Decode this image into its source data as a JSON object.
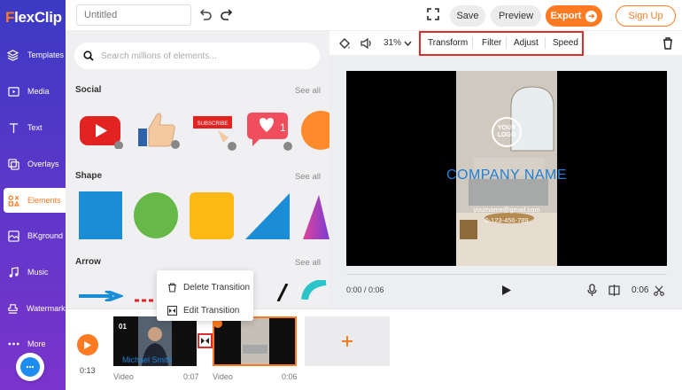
{
  "brand": {
    "logo_f": "F",
    "logo_rest": "lexClip",
    "accent": "#ff7a21",
    "sidebar_gradient": [
      "#3b3ac4",
      "#7b34cc"
    ]
  },
  "sidebar": {
    "items": [
      {
        "label": "Templates",
        "icon": "layers-icon"
      },
      {
        "label": "Media",
        "icon": "media-icon"
      },
      {
        "label": "Text",
        "icon": "text-icon"
      },
      {
        "label": "Overlays",
        "icon": "overlays-icon"
      },
      {
        "label": "Elements",
        "icon": "elements-icon",
        "active": true
      },
      {
        "label": "BKground",
        "icon": "background-icon"
      },
      {
        "label": "Music",
        "icon": "music-icon"
      },
      {
        "label": "Watermark",
        "icon": "watermark-icon"
      },
      {
        "label": "More",
        "icon": "more-icon"
      }
    ],
    "chat_icon": "chat-icon"
  },
  "topbar": {
    "title_placeholder": "Untitled",
    "save_label": "Save",
    "preview_label": "Preview",
    "export_label": "Export",
    "signup_label": "Sign Up"
  },
  "elements_panel": {
    "search_placeholder": "Search millions of elements...",
    "sections": [
      {
        "title": "Social",
        "see_all": "See all"
      },
      {
        "title": "Shape",
        "see_all": "See all"
      },
      {
        "title": "Arrow",
        "see_all": "See all"
      }
    ],
    "social_badge_text": "1",
    "subscribe_text": "SUBSCRIBE"
  },
  "toolbar": {
    "opacity": "31%",
    "transform_label": "Transform",
    "filter_label": "Filter",
    "adjust_label": "Adjust",
    "speed_label": "Speed"
  },
  "preview": {
    "logo_line1": "YOUR",
    "logo_line2": "LOGO",
    "company_name": "COMPANY NAME",
    "email": "yourname@gmail.com",
    "phone": "0-123-456-789",
    "time_display": "0:00 / 0:06",
    "duration_display": "0:06"
  },
  "timeline": {
    "time": "0:13",
    "clips": [
      {
        "label": "Video",
        "duration": "0:07",
        "badge": "01",
        "caption": "Michael Smith"
      },
      {
        "label": "Video",
        "duration": "0:06"
      }
    ]
  },
  "context_menu": {
    "delete_label": "Delete Transition",
    "edit_label": "Edit Transition"
  }
}
